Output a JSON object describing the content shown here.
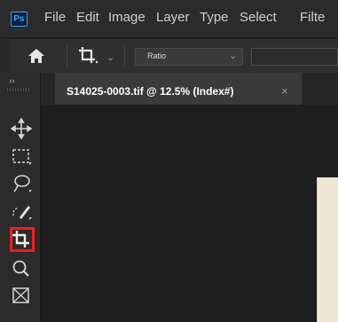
{
  "app": {
    "logo_text": "Ps",
    "menu": [
      "File",
      "Edit",
      "Image",
      "Layer",
      "Type",
      "Select",
      "Filte"
    ]
  },
  "options_bar": {
    "ratio_select_value": "Ratio"
  },
  "document_tab": {
    "title": "S14025-0003.tif @ 12.5% (Index#)",
    "close_glyph": "×"
  },
  "toolbar": {
    "collapse_glyph": "››",
    "tools": [
      "move-icon",
      "rect-marquee-icon",
      "lasso-icon",
      "quick-selection-icon",
      "crop-icon",
      "zoom-icon",
      "frame-icon"
    ],
    "selected_tool": "crop-icon",
    "highlight_color": "#ff1a1a"
  },
  "colors": {
    "accent_blue": "#31a8ff",
    "document_paper": "#efe6d4"
  }
}
